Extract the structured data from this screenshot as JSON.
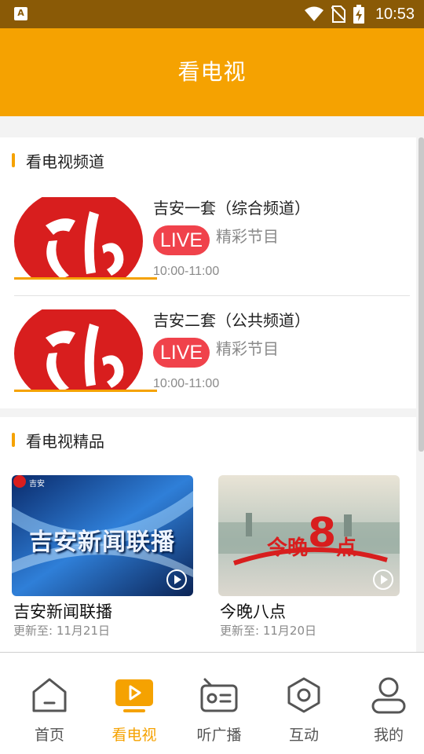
{
  "status_bar": {
    "time": "10:53",
    "app_badge": "A"
  },
  "header": {
    "title": "看电视"
  },
  "channels_section": {
    "title": "看电视频道",
    "items": [
      {
        "name": "吉安一套（综合频道）",
        "live_label": "LIVE",
        "program": "精彩节目",
        "time": "10:00-11:00"
      },
      {
        "name": "吉安二套（公共频道）",
        "live_label": "LIVE",
        "program": "精彩节目",
        "time": "10:00-11:00"
      }
    ]
  },
  "featured_section": {
    "title": "看电视精品",
    "items": [
      {
        "title": "吉安新闻联播",
        "updated": "更新至: 11月21日",
        "poster_text": "吉安新闻联播",
        "logo_text": "吉安"
      },
      {
        "title": "今晚八点",
        "updated": "更新至: 11月20日",
        "poster_text_a": "今晚",
        "poster_text_b": "8",
        "poster_text_c": "点"
      }
    ]
  },
  "tab_bar": {
    "active_index": 1,
    "items": [
      {
        "label": "首页",
        "icon": "home-icon"
      },
      {
        "label": "看电视",
        "icon": "tv-icon"
      },
      {
        "label": "听广播",
        "icon": "radio-icon"
      },
      {
        "label": "互动",
        "icon": "interact-icon"
      },
      {
        "label": "我的",
        "icon": "profile-icon"
      }
    ]
  },
  "colors": {
    "accent": "#f5a201",
    "status_bar": "#8a5a06",
    "live_badge": "#f0424b",
    "logo_red": "#d81e1e"
  }
}
